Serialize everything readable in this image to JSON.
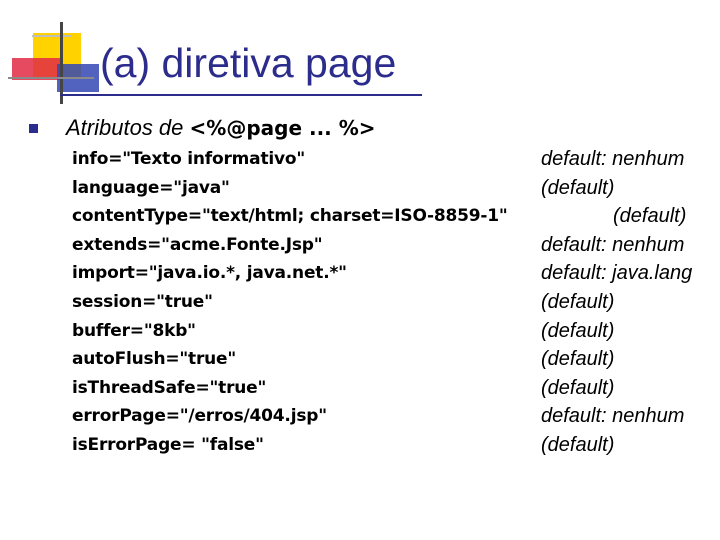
{
  "title": "(a) diretiva page",
  "subheading": {
    "lead": "Atributos de ",
    "code": "<%@page ... %>"
  },
  "attributes": [
    {
      "attr": "info=\"Texto informativo\"",
      "default": "default: nenhum"
    },
    {
      "attr": "language=\"java\"",
      "default": "(default)"
    },
    {
      "attr": "contentType=\"text/html; charset=ISO-8859-1\"",
      "default": "(default)"
    },
    {
      "attr": "extends=\"acme.Fonte.Jsp\"",
      "default": "default: nenhum"
    },
    {
      "attr": "import=\"java.io.*, java.net.*\"",
      "default": "default: java.lang"
    },
    {
      "attr": "session=\"true\"",
      "default": "(default)"
    },
    {
      "attr": "buffer=\"8kb\"",
      "default": "(default)"
    },
    {
      "attr": "autoFlush=\"true\"",
      "default": "(default)"
    },
    {
      "attr": "isThreadSafe=\"true\"",
      "default": "(default)"
    },
    {
      "attr": "errorPage=\"/erros/404.jsp\"",
      "default": "default: nenhum"
    },
    {
      "attr": "isErrorPage= \"false\"",
      "default": "(default)"
    }
  ]
}
